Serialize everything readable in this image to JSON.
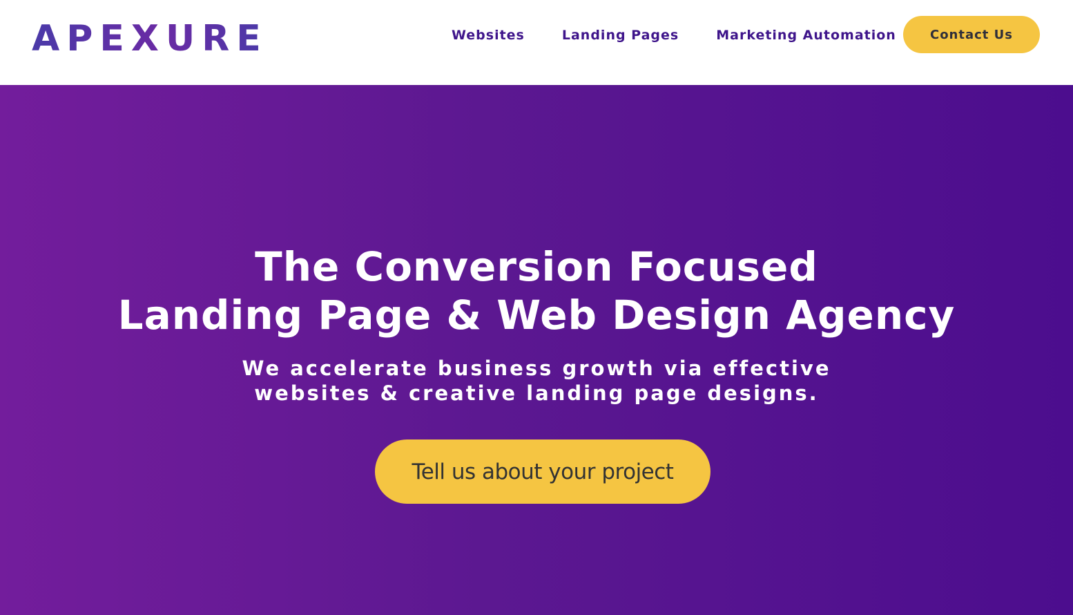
{
  "header": {
    "logo_text": "APEXURE",
    "nav": [
      {
        "label": "Websites"
      },
      {
        "label": "Landing Pages"
      },
      {
        "label": "Marketing Automation"
      }
    ],
    "contact_label": "Contact Us"
  },
  "hero": {
    "title_line1": "The Conversion Focused",
    "title_line2": "Landing Page & Web Design Agency",
    "subtitle_line1": "We accelerate business growth via effective",
    "subtitle_line2": "websites & creative landing page designs.",
    "cta_label": "Tell us about your project"
  },
  "colors": {
    "brand_purple": "#3f158b",
    "hero_gradient_start": "#731d9c",
    "hero_gradient_end": "#4c0d8e",
    "accent_yellow": "#f5c542"
  }
}
